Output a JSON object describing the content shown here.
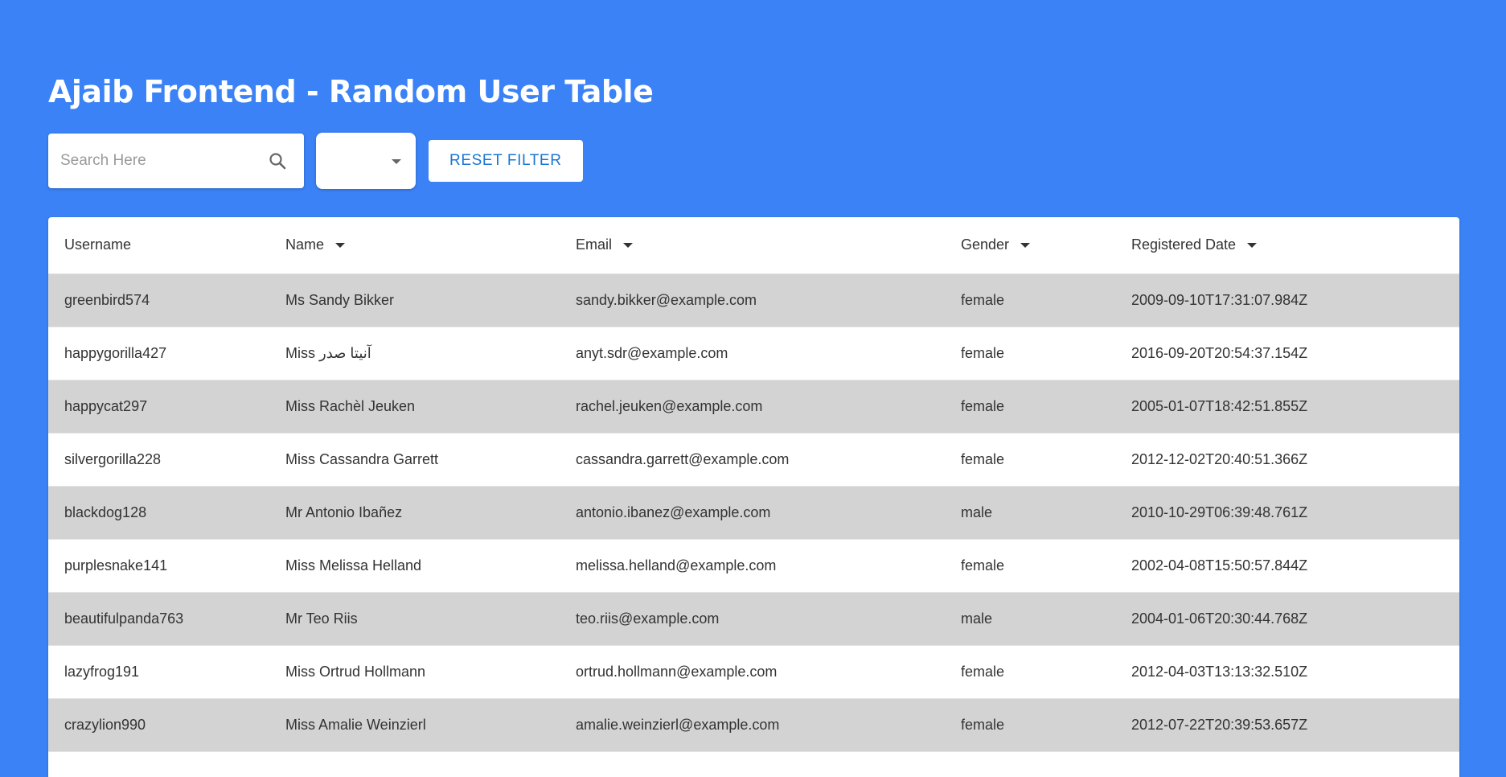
{
  "header": {
    "title": "Ajaib Frontend - Random User Table"
  },
  "toolbar": {
    "search_placeholder": "Search Here",
    "search_value": "",
    "gender_selected": "",
    "reset_label": "RESET FILTER"
  },
  "table": {
    "columns": [
      {
        "label": "Username",
        "sortable": false
      },
      {
        "label": "Name",
        "sortable": true
      },
      {
        "label": "Email",
        "sortable": true
      },
      {
        "label": "Gender",
        "sortable": true
      },
      {
        "label": "Registered Date",
        "sortable": true
      }
    ],
    "rows": [
      {
        "username": "greenbird574",
        "name": "Ms Sandy Bikker",
        "email": "sandy.bikker@example.com",
        "gender": "female",
        "registered": "2009-09-10T17:31:07.984Z"
      },
      {
        "username": "happygorilla427",
        "name": "Miss آنیتا صدر",
        "email": "anyt.sdr@example.com",
        "gender": "female",
        "registered": "2016-09-20T20:54:37.154Z"
      },
      {
        "username": "happycat297",
        "name": "Miss Rachèl Jeuken",
        "email": "rachel.jeuken@example.com",
        "gender": "female",
        "registered": "2005-01-07T18:42:51.855Z"
      },
      {
        "username": "silvergorilla228",
        "name": "Miss Cassandra Garrett",
        "email": "cassandra.garrett@example.com",
        "gender": "female",
        "registered": "2012-12-02T20:40:51.366Z"
      },
      {
        "username": "blackdog128",
        "name": "Mr Antonio Ibañez",
        "email": "antonio.ibanez@example.com",
        "gender": "male",
        "registered": "2010-10-29T06:39:48.761Z"
      },
      {
        "username": "purplesnake141",
        "name": "Miss Melissa Helland",
        "email": "melissa.helland@example.com",
        "gender": "female",
        "registered": "2002-04-08T15:50:57.844Z"
      },
      {
        "username": "beautifulpanda763",
        "name": "Mr Teo Riis",
        "email": "teo.riis@example.com",
        "gender": "male",
        "registered": "2004-01-06T20:30:44.768Z"
      },
      {
        "username": "lazyfrog191",
        "name": "Miss Ortrud Hollmann",
        "email": "ortrud.hollmann@example.com",
        "gender": "female",
        "registered": "2012-04-03T13:13:32.510Z"
      },
      {
        "username": "crazylion990",
        "name": "Miss Amalie Weinzierl",
        "email": "amalie.weinzierl@example.com",
        "gender": "female",
        "registered": "2012-07-22T20:39:53.657Z"
      }
    ]
  }
}
